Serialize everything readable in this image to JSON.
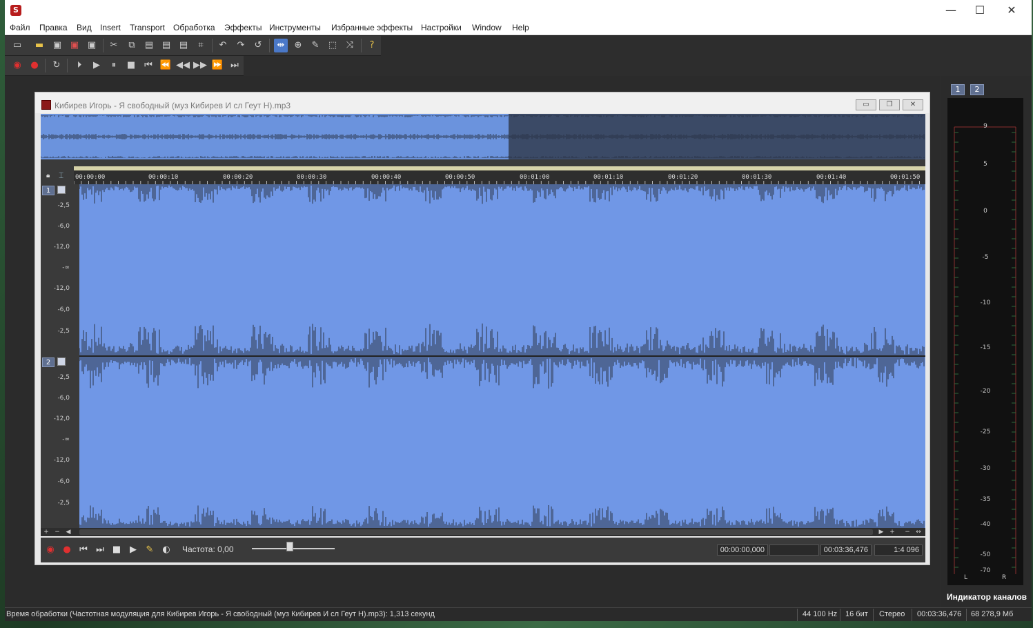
{
  "window": {
    "app_icon_letter": "S",
    "minimize": "—",
    "maximize": "☐",
    "close": "✕"
  },
  "menu": [
    "Файл",
    "Правка",
    "Вид",
    "Insert",
    "Transport",
    "Обработка",
    "Эффекты",
    "Инструменты",
    "Избранные эффекты",
    "Настройки",
    "Window",
    "Help"
  ],
  "document": {
    "title": "Кибирев Игорь - Я свободный (муз Кибирев И сл Геут Н).mp3",
    "time_labels": [
      "00:00:00",
      "00:00:10",
      "00:00:20",
      "00:00:30",
      "00:00:40",
      "00:00:50",
      "00:01:00",
      "00:01:10",
      "00:01:20",
      "00:01:30",
      "00:01:40",
      "00:01:50"
    ],
    "db_labels_ch1": [
      "-2,5",
      "-6,0",
      "-12,0",
      "-∞",
      "-12,0",
      "-6,0",
      "-2,5"
    ],
    "db_labels_ch2": [
      "-2,5",
      "-6,0",
      "-12,0",
      "-∞",
      "-12,0",
      "-6,0",
      "-2,5"
    ],
    "channels": [
      "1",
      "2"
    ],
    "frequency_label": "Частота: 0,00",
    "sel_start": "00:00:00,000",
    "sel_length": "",
    "total_length": "00:03:36,476",
    "zoom": "1:4 096"
  },
  "meter": {
    "tabs": [
      "1",
      "2"
    ],
    "labels": [
      "9",
      "5",
      "0",
      "-5",
      "-10",
      "-15",
      "-20",
      "-25",
      "-30",
      "-35",
      "-40",
      "-50",
      "-70"
    ],
    "left": "L",
    "right": "R",
    "caption": "Индикатор каналов"
  },
  "status": {
    "message": "Время обработки (Частотная модуляция для Кибирев Игорь - Я свободный (муз Кибирев И сл Геут Н).mp3): 1,313 секунд",
    "sample_rate": "44 100 Hz",
    "bit_depth": "16 бит",
    "channels": "Стерео",
    "length": "00:03:36,476",
    "free_space": "68 278,9 Мб"
  },
  "colors": {
    "waveform_bg": "#7097e6",
    "overview_sel": "#6b93dd",
    "wave_line": "#2b3447"
  }
}
